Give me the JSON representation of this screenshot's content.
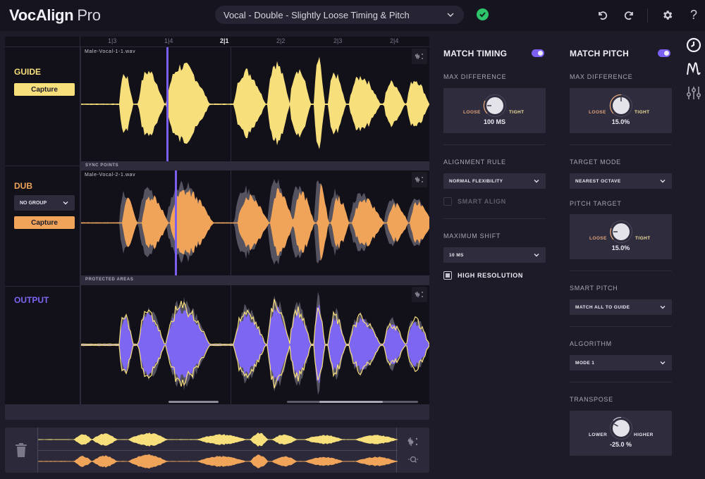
{
  "app": {
    "title_bold": "VocAlign",
    "title_light": "Pro"
  },
  "header": {
    "preset": "Vocal - Double - Slightly Loose Timing & Pitch",
    "status_icon": "check-circle-icon",
    "buttons": [
      {
        "name": "undo",
        "icon": "undo-icon"
      },
      {
        "name": "redo",
        "icon": "redo-icon"
      },
      {
        "name": "settings",
        "icon": "gear-icon"
      },
      {
        "name": "help",
        "icon": "help-icon",
        "glyph": "?"
      }
    ]
  },
  "ruler": {
    "ticks": [
      {
        "label": "1|3",
        "major": false
      },
      {
        "label": "1|4",
        "major": false
      },
      {
        "label": "2|1",
        "major": true
      },
      {
        "label": "2|2",
        "major": false
      },
      {
        "label": "2|3",
        "major": false
      },
      {
        "label": "2|4",
        "major": false
      }
    ]
  },
  "tracks": {
    "guide": {
      "name": "GUIDE",
      "capture": "Capture",
      "file": "Male-Vocal-1-1.wav",
      "color": "#f7df7c"
    },
    "sync_points_label": "SYNC POINTS",
    "dub": {
      "name": "DUB",
      "group": "NO GROUP",
      "capture": "Capture",
      "file": "Male-Vocal-2-1.wav",
      "color": "#f0a45a"
    },
    "protected_areas_label": "PROTECTED AREAS",
    "output": {
      "name": "OUTPUT",
      "color": "#7d66f2"
    }
  },
  "overview": {
    "delete_icon": "trash-icon",
    "tools": [
      "waveform-zoom-icon",
      "zoom-magnifier-icon"
    ]
  },
  "match_timing": {
    "title": "MATCH TIMING",
    "enabled": true,
    "max_difference": {
      "label": "MAX DIFFERENCE",
      "min_label": "LOOSE",
      "max_label": "TIGHT",
      "value": "100 MS"
    },
    "alignment_rule": {
      "label": "ALIGNMENT RULE",
      "value": "NORMAL FLEXIBILITY"
    },
    "smart_align": {
      "label": "SMART ALIGN",
      "checked": false,
      "enabled": false
    },
    "maximum_shift": {
      "label": "MAXIMUM SHIFT",
      "value": "10 MS"
    },
    "high_resolution": {
      "label": "HIGH RESOLUTION",
      "checked": true
    }
  },
  "match_pitch": {
    "title": "MATCH PITCH",
    "enabled": true,
    "max_difference": {
      "label": "MAX DIFFERENCE",
      "min_label": "LOOSE",
      "max_label": "TIGHT",
      "value": "15.0%"
    },
    "target_mode": {
      "label": "TARGET MODE",
      "value": "NEAREST OCTAVE"
    },
    "pitch_target": {
      "label": "PITCH TARGET",
      "min_label": "LOOSE",
      "max_label": "TIGHT",
      "value": "15.0%"
    },
    "smart_pitch": {
      "label": "SMART PITCH",
      "value": "MATCH ALL TO GUIDE"
    },
    "algorithm": {
      "label": "ALGORITHM",
      "value": "MODE 1"
    },
    "transpose": {
      "label": "TRANSPOSE",
      "min_label": "LOWER",
      "max_label": "HIGHER",
      "value": "-25.0 %"
    }
  },
  "side_tabs": [
    {
      "name": "timing",
      "icon": "clock-icon"
    },
    {
      "name": "pitch",
      "icon": "pitch-wave-icon"
    },
    {
      "name": "mixer",
      "icon": "sliders-icon"
    }
  ]
}
